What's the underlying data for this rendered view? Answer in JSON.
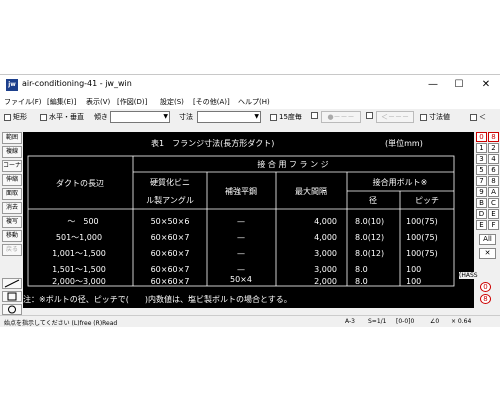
{
  "window": {
    "title": "air-conditioning-41 - jw_win",
    "icon_text": "jw",
    "minimize": "—",
    "maximize": "☐",
    "close": "✕"
  },
  "menu": [
    "ファイル(F)",
    "[編集(E)]",
    "表示(V)",
    "[作図(D)]",
    "設定(S)",
    "[その他(A)]",
    "ヘルプ(H)"
  ],
  "toolbar": {
    "rect": "矩形",
    "hv": "水平・垂直",
    "tilt": "傾き",
    "dim": "寸法",
    "deg15": "15度毎",
    "btn1": "●－－－",
    "btn2": "＜－－－",
    "dimval": "寸法値",
    "lt": "＜"
  },
  "left_tools": [
    "範囲",
    "複線",
    "コーナー",
    "伸縮",
    "面取",
    "消去",
    "複写",
    "移動",
    "戻る"
  ],
  "right_tools": {
    "pairs": [
      [
        "0",
        "8"
      ],
      [
        "1",
        "2"
      ],
      [
        "3",
        "4"
      ],
      [
        "5",
        "6"
      ],
      [
        "7",
        "8"
      ],
      [
        "9",
        "A"
      ],
      [
        "B",
        "C"
      ],
      [
        "D",
        "E"
      ],
      [
        "E",
        "F"
      ]
    ],
    "all": "All",
    "hass": "(HASS",
    "bottom": [
      "0",
      "8"
    ]
  },
  "drawing": {
    "title": "表1　フランジ寸法(長方形ダクト)",
    "unit": "(単位mm)",
    "header_main": "接 合 用 フ ラ ン ジ",
    "col_duct": "ダクトの長辺",
    "col_angle_1": "硬質化ビニ",
    "col_angle_2": "ル製アングル",
    "col_reinforce": "補強平鋼",
    "col_max": "最大間隔",
    "col_bolt": "接合用ボルト※",
    "col_diam": "径",
    "col_pitch": "ピッチ",
    "rows": [
      [
        "～　500",
        "50×50×6",
        "—",
        "4,000",
        "8.0(10)",
        "100(75)"
      ],
      [
        "501～1,000",
        "60×60×7",
        "—",
        "4,000",
        "8.0(12)",
        "100(75)"
      ],
      [
        "1,001～1,500",
        "60×60×7",
        "—",
        "3,000",
        "8.0(12)",
        "100(75)"
      ],
      [
        "1,501～1,500",
        "60×60×7",
        "—",
        "3,000",
        "8.0",
        "100"
      ],
      [
        "2,000～3,000",
        "60×60×7",
        "50×4",
        "2,000",
        "8.0",
        "100"
      ]
    ],
    "note": "注：※ボルトの径、ピッチで(　　)内数値は、塩ビ製ボルトの場合とする。"
  },
  "status": {
    "message": "始点を指示してください (L)free (R)Read",
    "scale": "A-3",
    "ratio": "S=1/1",
    "layer": "[0-0]0",
    "angle": "∠0",
    "zoom": "× 0.64"
  }
}
